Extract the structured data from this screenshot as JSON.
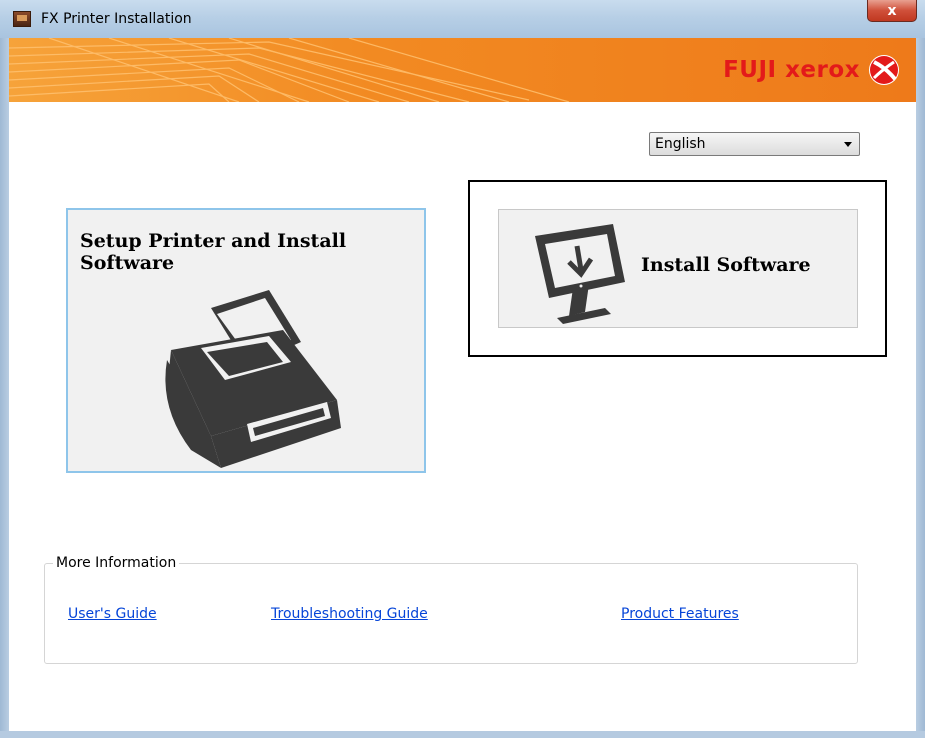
{
  "window": {
    "title": "FX Printer Installation",
    "close_label": "x"
  },
  "banner": {
    "brand_text": "FUJI xerox",
    "brand_color": "#e31a1a",
    "background_color": "#f28a22"
  },
  "language": {
    "selected": "English"
  },
  "tiles": {
    "setup": {
      "label": "Setup Printer and Install\nSoftware",
      "icon": "printer-icon"
    },
    "install": {
      "label": "Install Software",
      "icon": "monitor-download-icon"
    }
  },
  "more_info": {
    "legend": "More Information",
    "links": [
      {
        "label": "User's Guide"
      },
      {
        "label": "Troubleshooting Guide"
      },
      {
        "label": "Product Features"
      }
    ]
  }
}
